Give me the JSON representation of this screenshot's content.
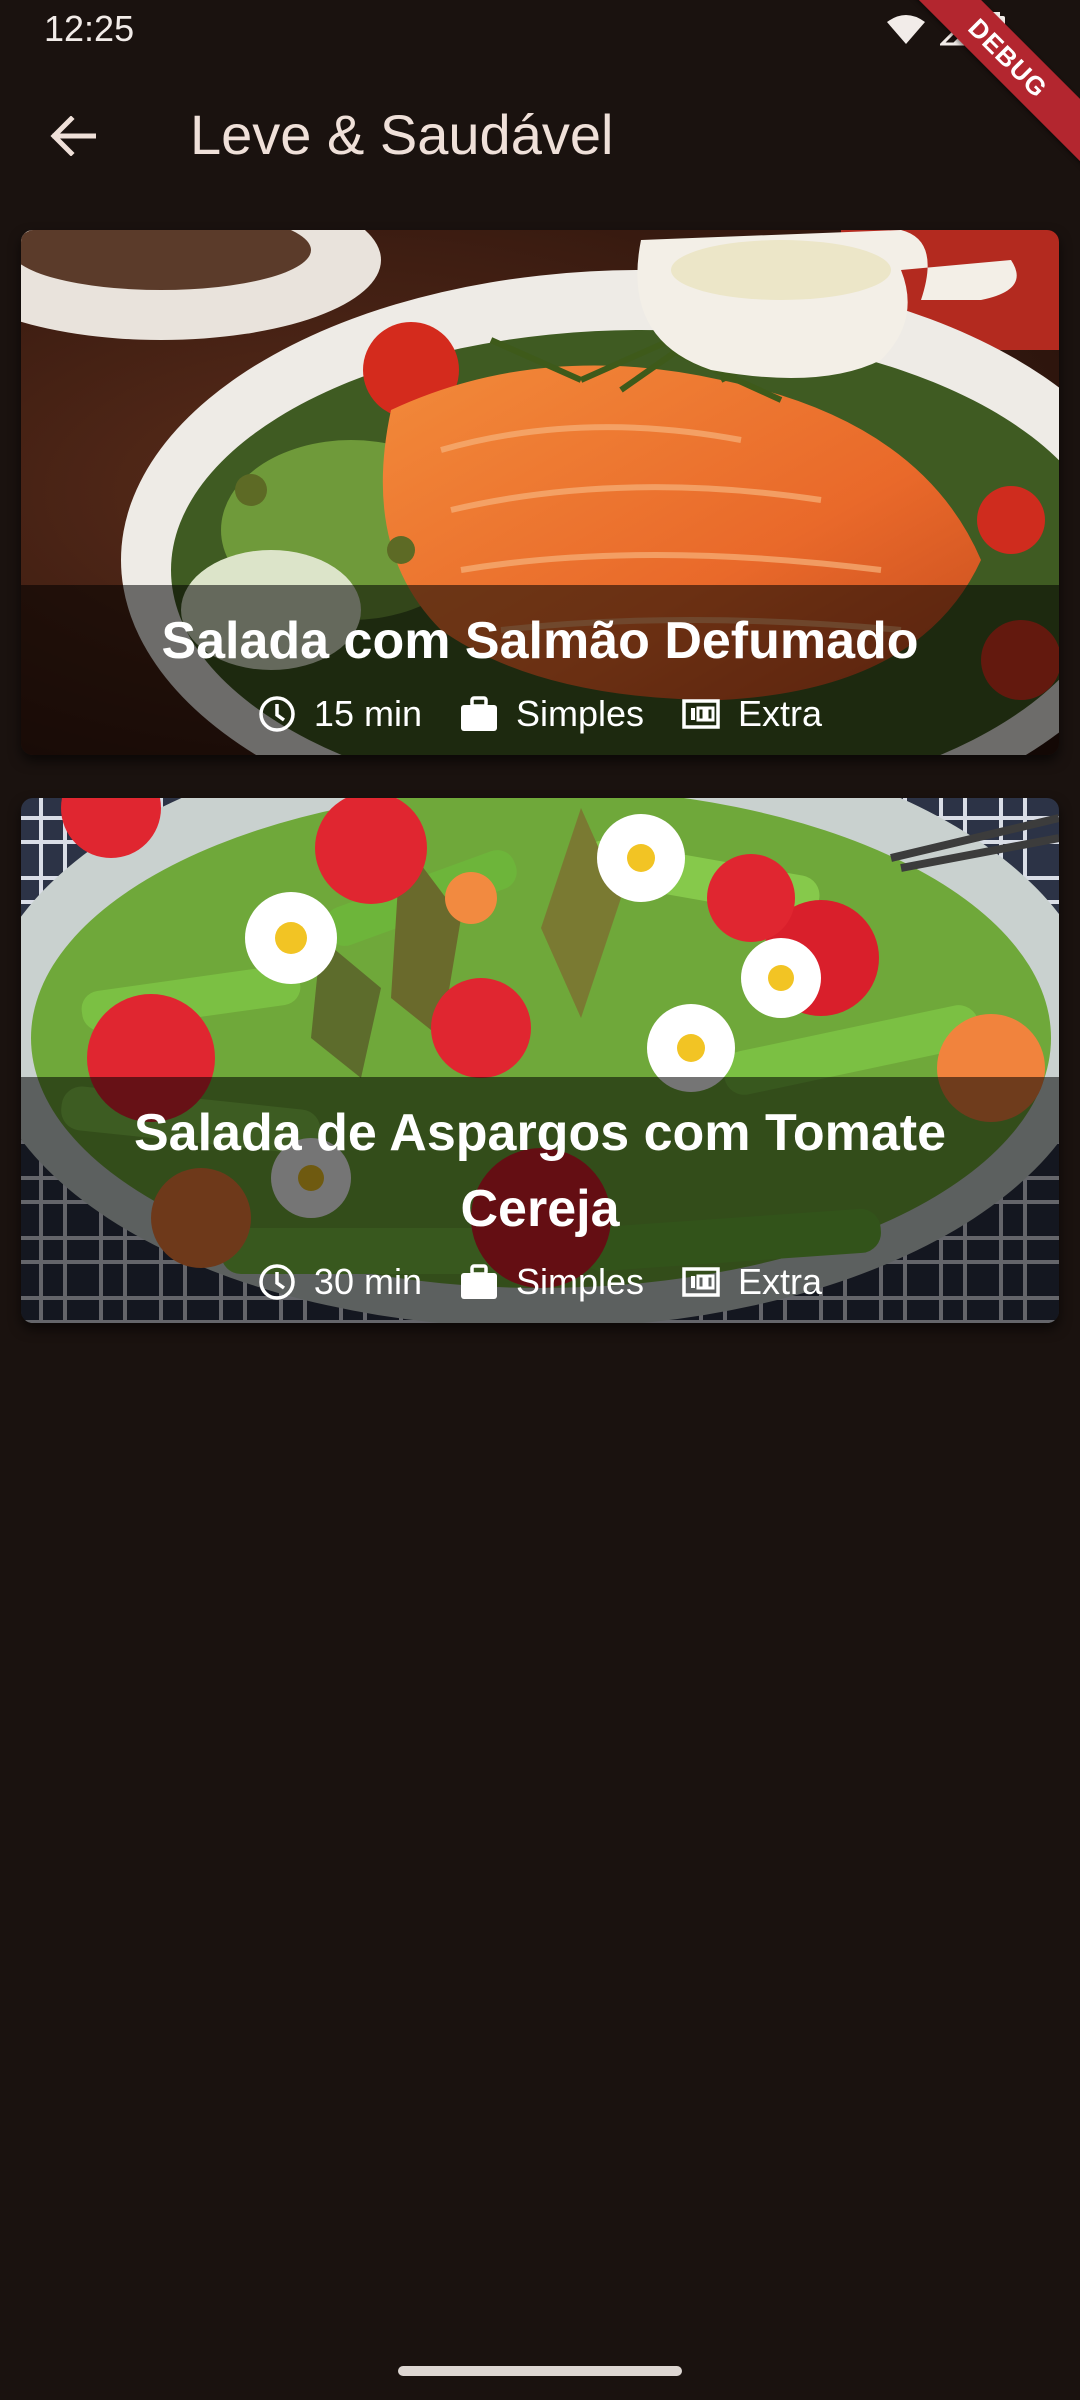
{
  "status_bar": {
    "time": "12:25",
    "icons": [
      "wifi-icon",
      "signal-icon",
      "battery-icon"
    ]
  },
  "debug_banner": "DEBUG",
  "app_bar": {
    "back_icon": "arrow-back-icon",
    "title": "Leve & Saudável"
  },
  "meals": [
    {
      "title": "Salada com Salmão Defumado",
      "duration": "15 min",
      "complexity": "Simples",
      "cost": "Extra",
      "image": "smoked-salmon-salad-photo"
    },
    {
      "title": "Salada de Aspargos com Tomate Cereja",
      "duration": "30 min",
      "complexity": "Simples",
      "cost": "Extra",
      "image": "asparagus-strawberry-salad-photo"
    }
  ],
  "colors": {
    "background": "#1a120f",
    "debug_banner": "#b3262f",
    "overlay": "rgba(0,0,0,0.54)"
  }
}
